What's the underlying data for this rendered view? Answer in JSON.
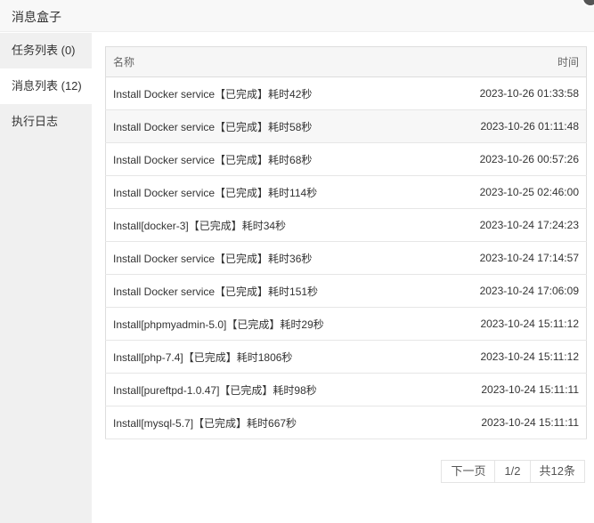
{
  "dialog": {
    "title": "消息盒子"
  },
  "sidebar": {
    "items": [
      {
        "label": "任务列表 (0)"
      },
      {
        "label": "消息列表 (12)"
      },
      {
        "label": "执行日志"
      }
    ]
  },
  "table": {
    "headers": {
      "name": "名称",
      "time": "时间"
    },
    "rows": [
      {
        "name": "Install Docker service【已完成】耗时42秒",
        "time": "2023-10-26 01:33:58"
      },
      {
        "name": "Install Docker service【已完成】耗时58秒",
        "time": "2023-10-26 01:11:48"
      },
      {
        "name": "Install Docker service【已完成】耗时68秒",
        "time": "2023-10-26 00:57:26"
      },
      {
        "name": "Install Docker service【已完成】耗时114秒",
        "time": "2023-10-25 02:46:00"
      },
      {
        "name": "Install[docker-3]【已完成】耗时34秒",
        "time": "2023-10-24 17:24:23"
      },
      {
        "name": "Install Docker service【已完成】耗时36秒",
        "time": "2023-10-24 17:14:57"
      },
      {
        "name": "Install Docker service【已完成】耗时151秒",
        "time": "2023-10-24 17:06:09"
      },
      {
        "name": "Install[phpmyadmin-5.0]【已完成】耗时29秒",
        "time": "2023-10-24 15:11:12"
      },
      {
        "name": "Install[php-7.4]【已完成】耗时1806秒",
        "time": "2023-10-24 15:11:12"
      },
      {
        "name": "Install[pureftpd-1.0.47]【已完成】耗时98秒",
        "time": "2023-10-24 15:11:11"
      },
      {
        "name": "Install[mysql-5.7]【已完成】耗时667秒",
        "time": "2023-10-24 15:11:11"
      }
    ]
  },
  "pagination": {
    "next_label": "下一页",
    "page_indicator": "1/2",
    "total_label": "共12条"
  }
}
